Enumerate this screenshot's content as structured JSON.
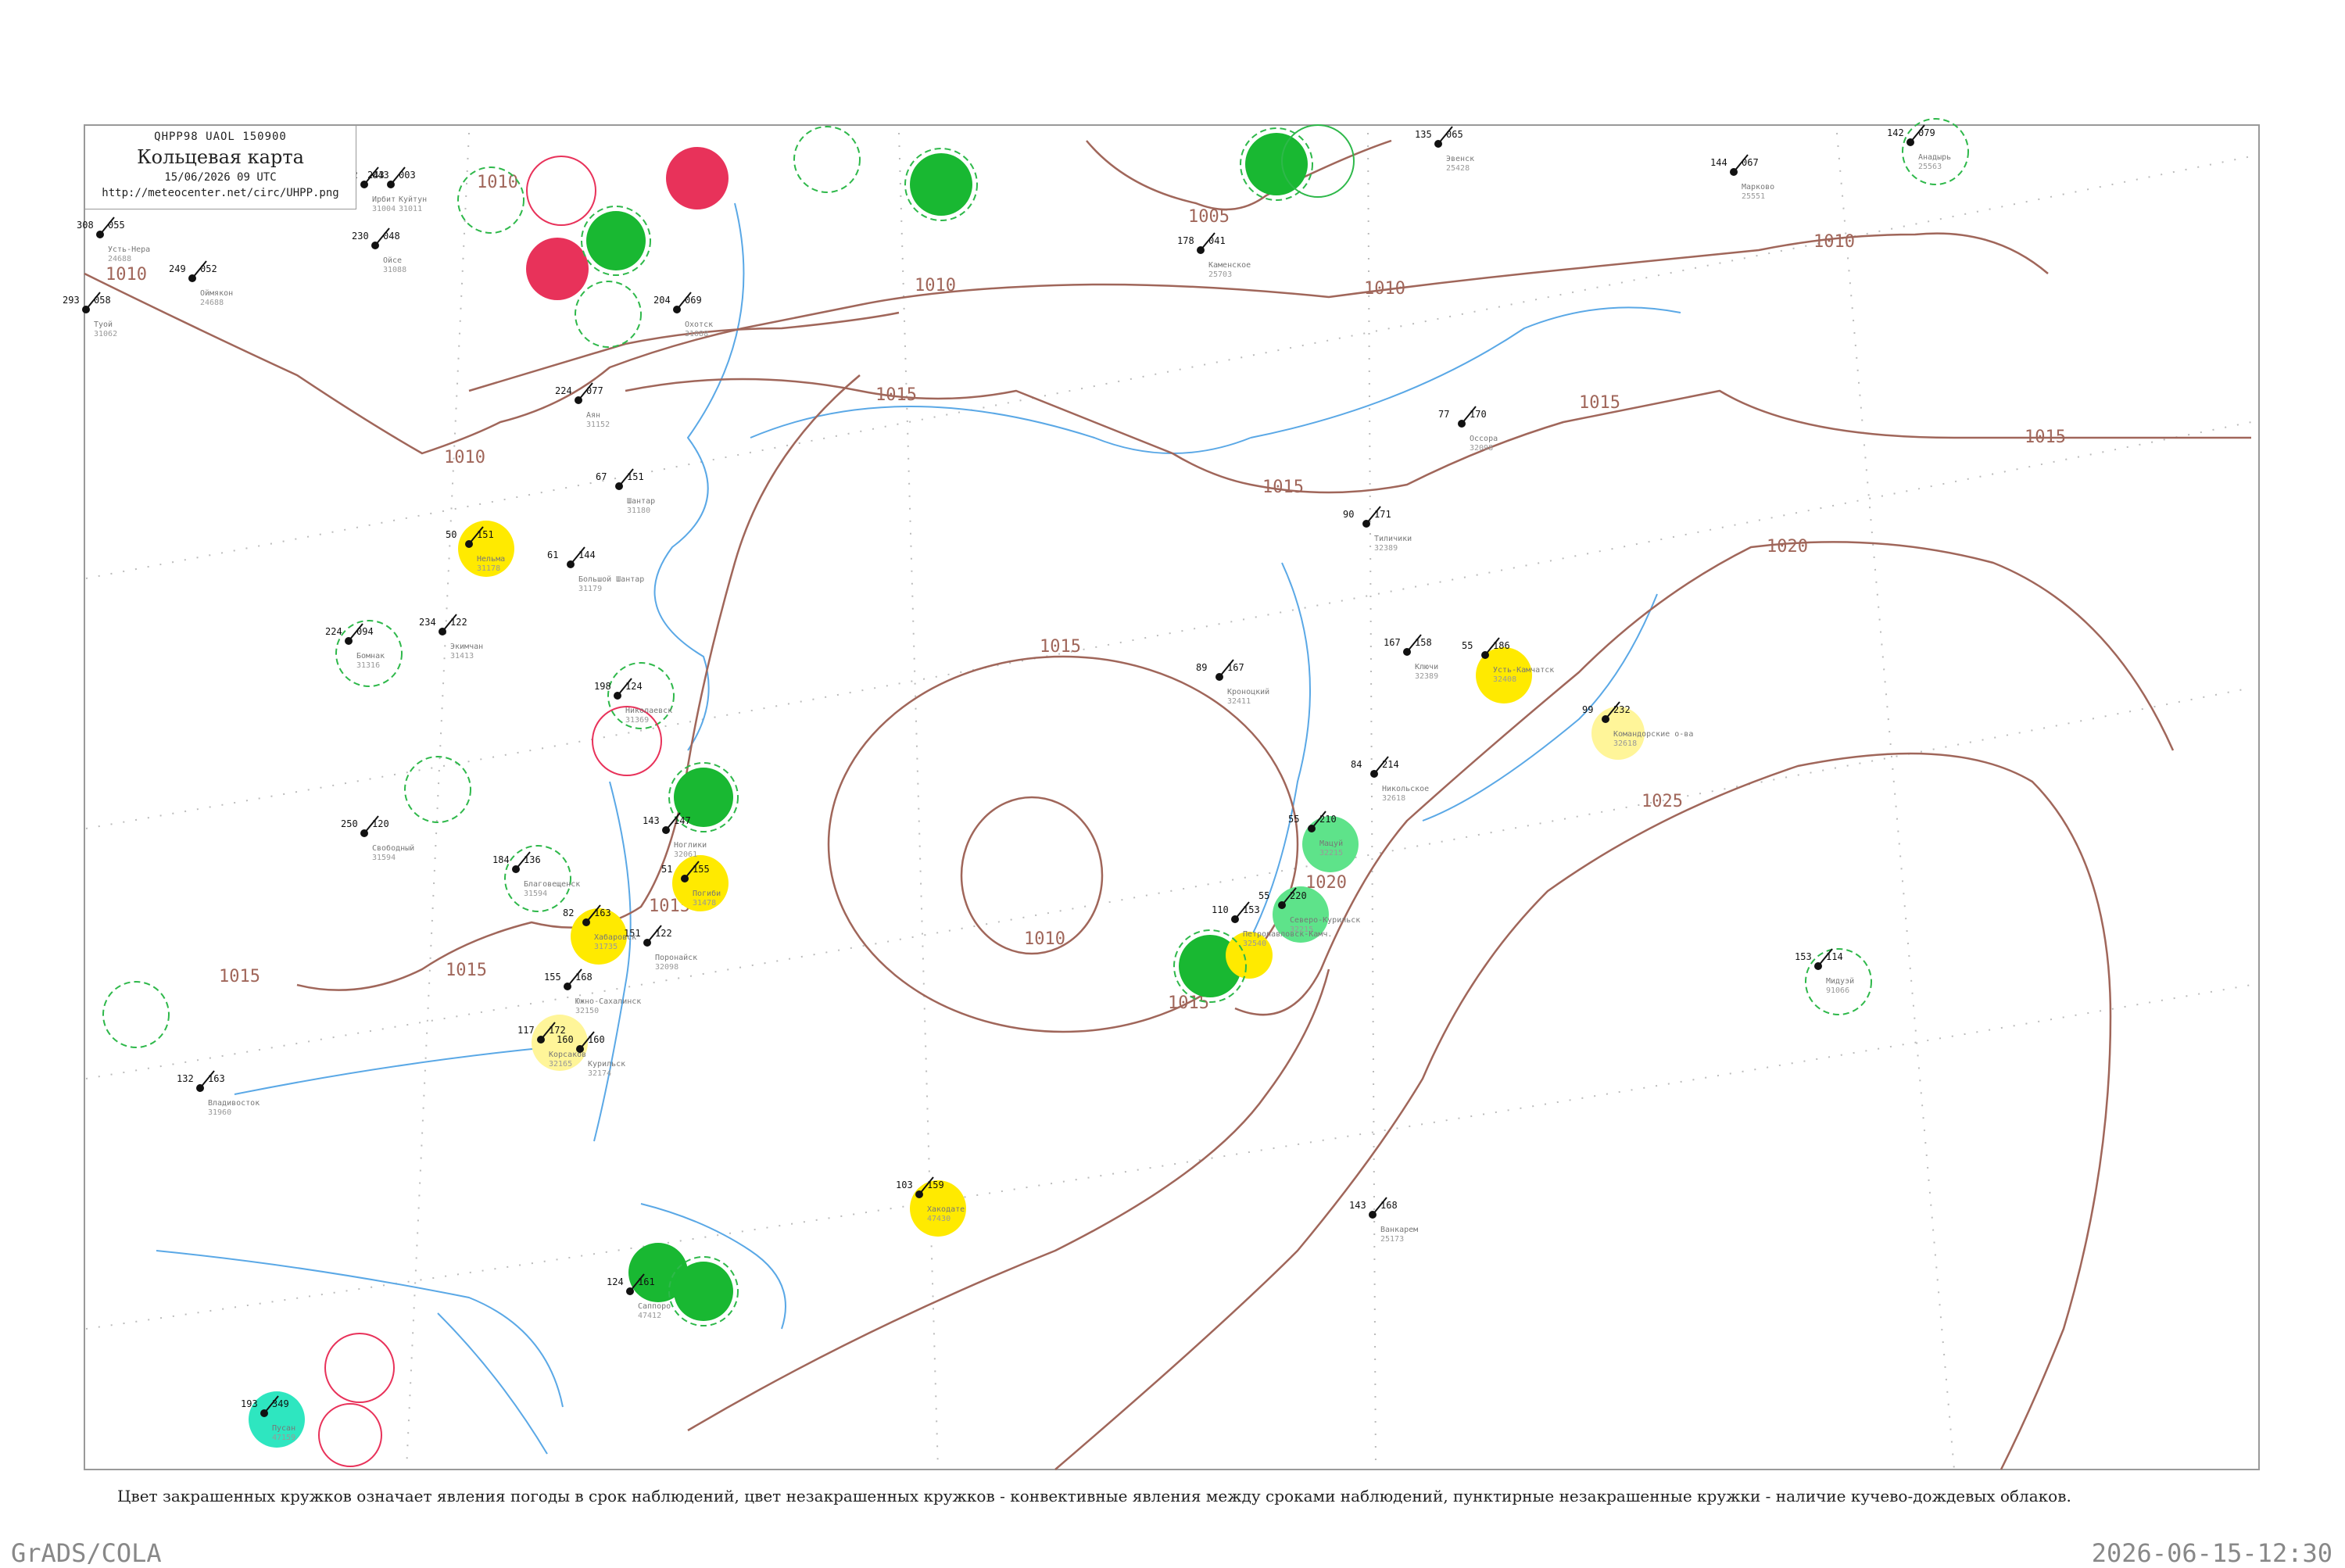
{
  "header": {
    "code_line": "QHPP98  UAOL  150900",
    "title": "Кольцевая карта",
    "datetime": "15/06/2026 09 UTC",
    "url": "http://meteocenter.net/circ/UHPP.png"
  },
  "footer": {
    "note": "Цвет закрашенных кружков означает явления погоды в срок наблюдений, цвет незакрашенных кружков - конвективные явления между сроками наблюдений, пунктирные незакрашенные кружки - наличие кучево-дождевых облаков.",
    "software": "GrADS/COLA",
    "timestamp": "2026-06-15-12:30"
  },
  "colors": {
    "isobar": "#a0665a",
    "coast": "#5aa8e6",
    "frame": "#999999",
    "thunder_red": "#e8325a",
    "rain_green": "#19b832",
    "shower_yellow": "#ffea00",
    "pale_yellow": "#fff599",
    "light_green": "#5ee38a",
    "teal": "#2ee6c0",
    "cb_dashed": "#2eb84a"
  },
  "isobar_labels": [
    "1010",
    "1010",
    "1010",
    "1010",
    "1010",
    "1005",
    "1010",
    "1015",
    "1015",
    "1015",
    "1015",
    "1015",
    "1015",
    "1015",
    "1020",
    "1020",
    "1025",
    "1010",
    "1015",
    "1015"
  ],
  "stations": [
    {
      "name": "Усть-Нера",
      "id": "24688",
      "t": "308",
      "ff": "055"
    },
    {
      "name": "Ирбит",
      "id": "31004",
      "t": "302",
      "ff": "043"
    },
    {
      "name": "Куйтун",
      "id": "31011",
      "t": "243",
      "ff": "003"
    },
    {
      "name": "Оймякон",
      "id": "24688",
      "t": "249",
      "ff": "052"
    },
    {
      "name": "Туой",
      "id": "31062",
      "t": "293",
      "ff": "058"
    },
    {
      "name": "Ойсе",
      "id": "31088",
      "t": "230",
      "ff": "048"
    },
    {
      "name": "Охотск",
      "id": "31088",
      "t": "204",
      "ff": "069"
    },
    {
      "name": "Аян",
      "id": "31152",
      "t": "224",
      "ff": "077"
    },
    {
      "name": "Шантар",
      "id": "31180",
      "t": "67",
      "ff": "151"
    },
    {
      "name": "Нельма",
      "id": "31178",
      "t": "50",
      "ff": "151"
    },
    {
      "name": "Большой Шантар",
      "id": "31179",
      "t": "61",
      "ff": "144"
    },
    {
      "name": "Бомнак",
      "id": "31316",
      "t": "224",
      "ff": "094"
    },
    {
      "name": "Экимчан",
      "id": "31413",
      "t": "234",
      "ff": "122"
    },
    {
      "name": "Николаевск",
      "id": "31369",
      "t": "198",
      "ff": "124"
    },
    {
      "name": "Ноглики",
      "id": "32061",
      "t": "143",
      "ff": "147"
    },
    {
      "name": "Поронайск",
      "id": "32098",
      "t": "151",
      "ff": "122"
    },
    {
      "name": "Погиби",
      "id": "31478",
      "t": "51",
      "ff": "155"
    },
    {
      "name": "Свободный",
      "id": "31594",
      "t": "250",
      "ff": "120"
    },
    {
      "name": "Благовещенск",
      "id": "31594",
      "t": "184",
      "ff": "136"
    },
    {
      "name": "Хабаровск",
      "id": "31735",
      "t": "82",
      "ff": "163"
    },
    {
      "name": "Южно-Сахалинск",
      "id": "32150",
      "t": "155",
      "ff": "168"
    },
    {
      "name": "Корсаков",
      "id": "32165",
      "t": "117",
      "ff": "172"
    },
    {
      "name": "Курильск",
      "id": "32174",
      "t": "160",
      "ff": "160"
    },
    {
      "name": "Владивосток",
      "id": "31960",
      "t": "132",
      "ff": "163"
    },
    {
      "name": "Мацуй",
      "id": "32215",
      "t": "55",
      "ff": "210"
    },
    {
      "name": "Северо-Курильск",
      "id": "32215",
      "t": "55",
      "ff": "220"
    },
    {
      "name": "Петропавловск-Камч.",
      "id": "32540",
      "t": "110",
      "ff": "153"
    },
    {
      "name": "Усть-Камчатск",
      "id": "32408",
      "t": "55",
      "ff": "186"
    },
    {
      "name": "Ключи",
      "id": "32389",
      "t": "167",
      "ff": "158"
    },
    {
      "name": "Кроноцкий",
      "id": "32411",
      "t": "89",
      "ff": "167"
    },
    {
      "name": "Командорские о-ва",
      "id": "32618",
      "t": "99",
      "ff": "232"
    },
    {
      "name": "Никольское",
      "id": "32618",
      "t": "84",
      "ff": "214"
    },
    {
      "name": "Анадырь",
      "id": "25563",
      "t": "142",
      "ff": "079"
    },
    {
      "name": "Марково",
      "id": "25551",
      "t": "144",
      "ff": "067"
    },
    {
      "name": "Эвенск",
      "id": "25428",
      "t": "135",
      "ff": "065"
    },
    {
      "name": "Каменское",
      "id": "25703",
      "t": "178",
      "ff": "041"
    },
    {
      "name": "Оссора",
      "id": "32098",
      "t": "77",
      "ff": "170"
    },
    {
      "name": "Тиличики",
      "id": "32389",
      "t": "90",
      "ff": "171"
    },
    {
      "name": "Мидуэй",
      "id": "91066",
      "t": "153",
      "ff": "114"
    },
    {
      "name": "Хакодате",
      "id": "47430",
      "t": "103",
      "ff": "159"
    },
    {
      "name": "Саппоро",
      "id": "47412",
      "t": "124",
      "ff": "161"
    },
    {
      "name": "Ванкарем",
      "id": "25173",
      "t": "143",
      "ff": "168"
    },
    {
      "name": "Пусан",
      "id": "47159",
      "t": "193",
      "ff": "349"
    }
  ]
}
